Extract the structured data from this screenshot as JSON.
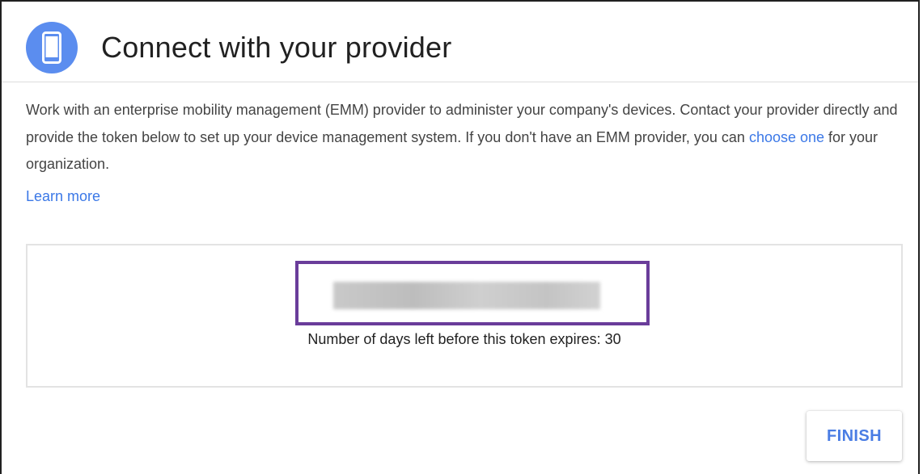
{
  "dialog": {
    "title": "Connect with your provider",
    "icon": "mobile-device-icon",
    "accent_color": "#5b8def"
  },
  "description": {
    "text_before_link": "Work with an enterprise mobility management (EMM) provider to administer your company's devices. Contact your provider directly and provide the token below to set up your device management system. If you don't have an EMM provider, you can ",
    "link_label": "choose one",
    "text_after_link": " for your organization."
  },
  "learn_more_label": "Learn more",
  "token": {
    "value": "",
    "expiry_text": "Number of days left before this token expires: 30",
    "highlight_color": "#6a3d9a"
  },
  "actions": {
    "finish_label": "FINISH",
    "link_color": "#3b78e7"
  }
}
